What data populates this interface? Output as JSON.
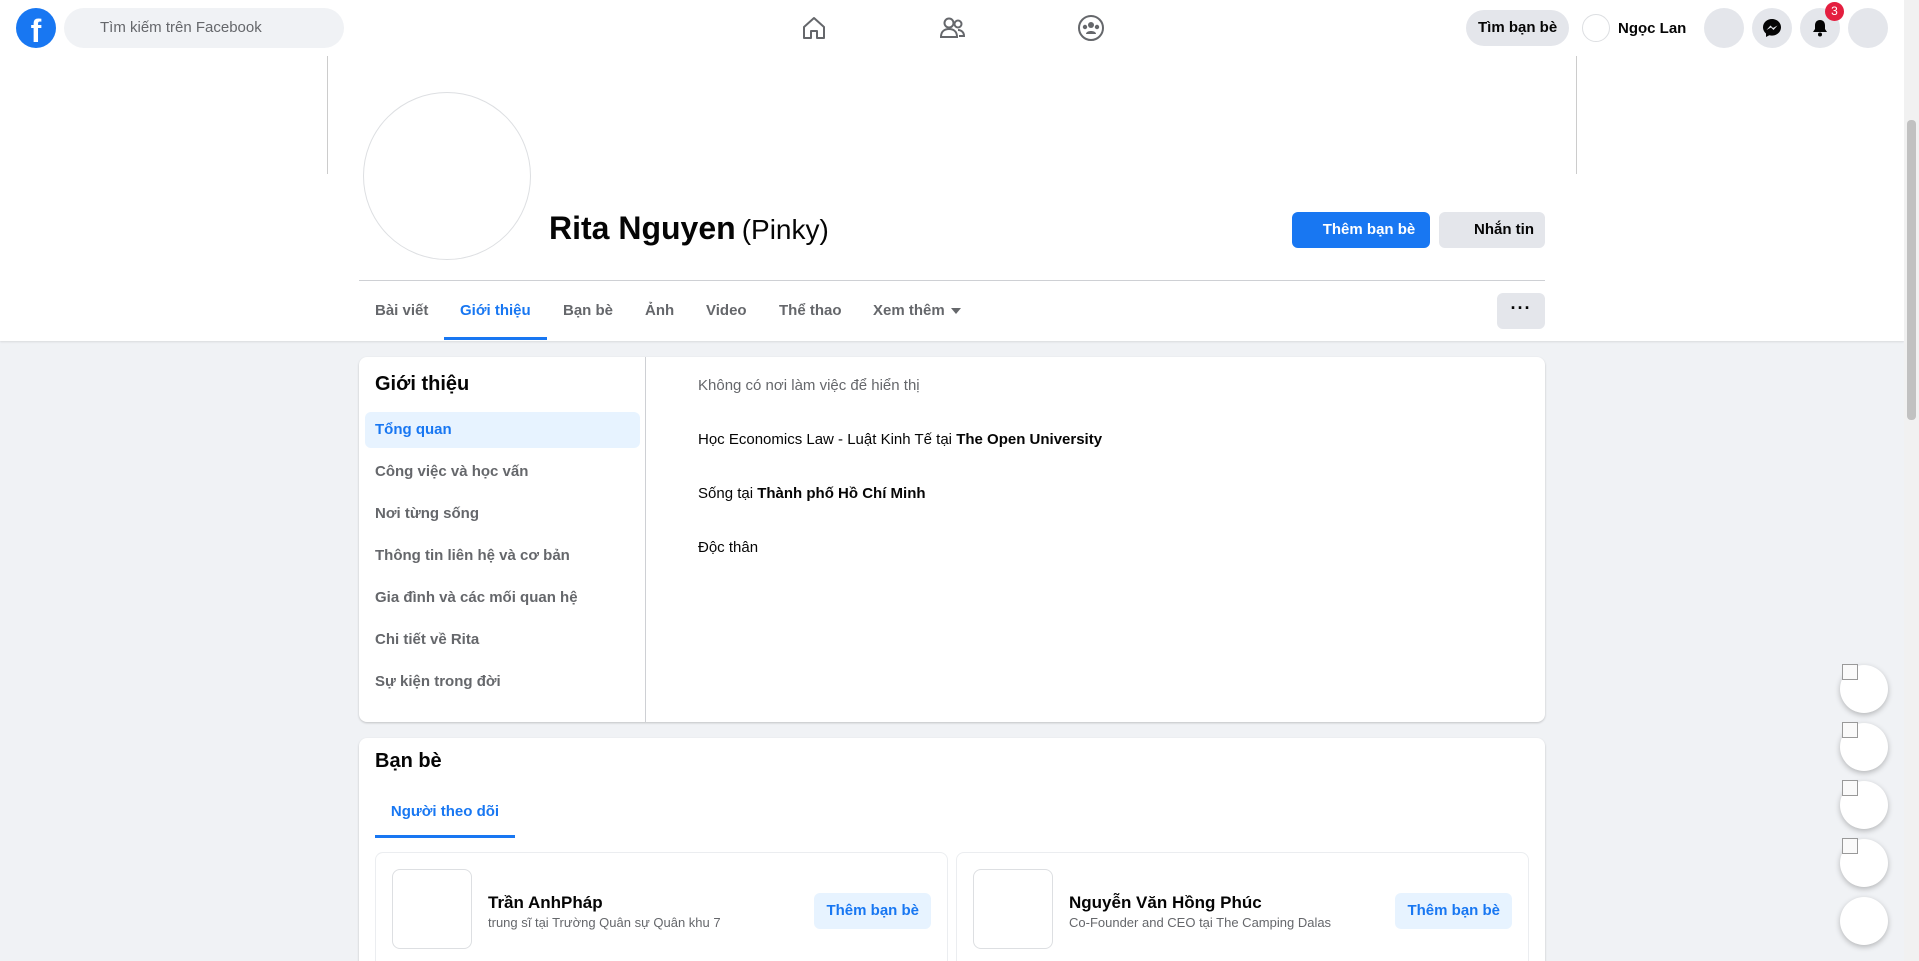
{
  "topbar": {
    "logo": "f",
    "search_placeholder": "Tìm kiếm trên Facebook",
    "nav_icons": [
      "home-icon",
      "friends-icon",
      "groups-icon"
    ],
    "find_friends_label": "Tìm bạn bè",
    "user_name": "Ngọc Lan",
    "notification_count": "3",
    "accent_color": "#1877f2"
  },
  "profile": {
    "name": "Rita Nguyen",
    "nickname": "(Pinky)",
    "add_friend_label": "Thêm bạn bè",
    "message_label": "Nhắn tin",
    "more_label": "···",
    "tabs": [
      "Bài viết",
      "Giới thiệu",
      "Bạn bè",
      "Ảnh",
      "Video",
      "Thể thao",
      "Xem thêm"
    ],
    "active_tab": "Giới thiệu"
  },
  "about": {
    "title": "Giới thiệu",
    "menu": [
      "Tổng quan",
      "Công việc và học vấn",
      "Nơi từng sống",
      "Thông tin liên hệ và cơ bản",
      "Gia đình và các mối quan hệ",
      "Chi tiết về Rita",
      "Sự kiện trong đời"
    ],
    "active_menu": "Tổng quan",
    "work": "Không có nơi làm việc để hiển thị",
    "study_prefix": "Học Economics Law - Luật Kinh Tế tại ",
    "study_school": "The Open University",
    "lives_prefix": "Sống tại ",
    "lives_city": "Thành phố Hồ Chí Minh",
    "relationship": "Độc thân"
  },
  "friends": {
    "title": "Bạn bè",
    "tab_label": "Người theo dõi",
    "items": [
      {
        "name": "Trần AnhPháp",
        "subtitle": "trung sĩ tại Trường Quân sự Quân khu 7",
        "action": "Thêm bạn bè"
      },
      {
        "name": "Nguyễn Văn Hồng Phúc",
        "subtitle": "Co-Founder and CEO tại The Camping Dalas",
        "action": "Thêm bạn bè"
      }
    ]
  }
}
